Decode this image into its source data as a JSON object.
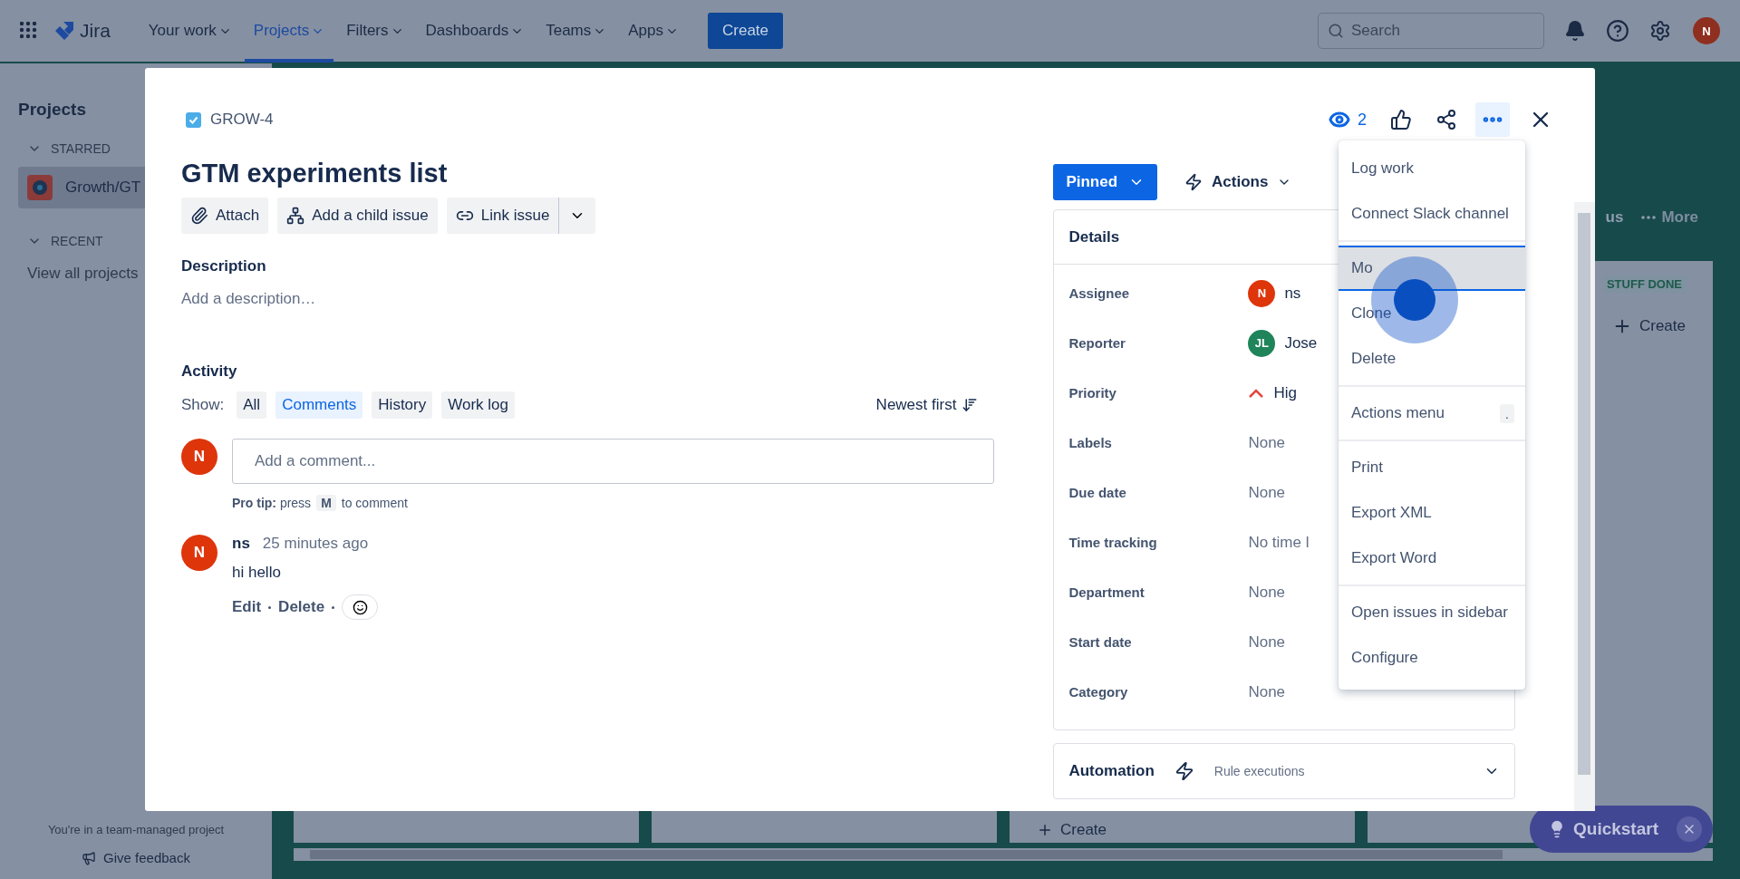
{
  "top_nav": {
    "product": "Jira",
    "items": [
      {
        "label": "Your work",
        "selected": false
      },
      {
        "label": "Projects",
        "selected": true
      },
      {
        "label": "Filters",
        "selected": false
      },
      {
        "label": "Dashboards",
        "selected": false
      },
      {
        "label": "Teams",
        "selected": false
      },
      {
        "label": "Apps",
        "selected": false
      }
    ],
    "create_button": "Create",
    "search": {
      "placeholder": "Search"
    },
    "avatar": "N"
  },
  "sidebar": {
    "title": "Projects",
    "starred_label": "STARRED",
    "starred_items": [
      {
        "label": "Growth/GT",
        "selected": true
      }
    ],
    "recent_label": "RECENT",
    "view_all": "View all projects",
    "footer_note": "You're in a team-managed project",
    "feedback": "Give feedback"
  },
  "board": {
    "header_fragment": "us",
    "more_button": "More",
    "column_tag": "STUFF DONE",
    "create_buttons": [
      "Create",
      "Create"
    ]
  },
  "quickstart": {
    "label": "Quickstart"
  },
  "issue": {
    "key": "GROW-4",
    "watchers": "2",
    "title": "GTM experiments list",
    "actions": [
      "Attach",
      "Add a child issue",
      "Link issue"
    ],
    "description_label": "Description",
    "description_placeholder": "Add a description…",
    "activity": {
      "label": "Activity",
      "show_label": "Show:",
      "filters": [
        {
          "label": "All",
          "selected": false
        },
        {
          "label": "Comments",
          "selected": true
        },
        {
          "label": "History",
          "selected": false
        },
        {
          "label": "Work log",
          "selected": false
        }
      ],
      "sort": "Newest first",
      "comment_box": {
        "avatar": "N",
        "placeholder": "Add a comment..."
      },
      "pro_tip": {
        "text": "**Pro tip:** press",
        "key": "M",
        "after": "to comment"
      },
      "comments": [
        {
          "author": "ns",
          "avatar": "N",
          "time": "25 minutes ago",
          "body": "hi hello",
          "links": [
            "Edit",
            "Delete"
          ]
        }
      ]
    },
    "status_button": "Pinned",
    "actions_button": "Actions",
    "details": {
      "title": "Details",
      "expanded": true,
      "fields": [
        {
          "label": "Assignee",
          "kind": "user",
          "avatar": "N",
          "color": "#de350b",
          "value": "ns"
        },
        {
          "label": "Reporter",
          "kind": "user",
          "avatar": "JL",
          "color": "#1f845a",
          "value": "Jose"
        },
        {
          "label": "Priority",
          "kind": "priority",
          "value": "Hig"
        },
        {
          "label": "Labels",
          "kind": "text",
          "value": "None"
        },
        {
          "label": "Due date",
          "kind": "text",
          "value": "None"
        },
        {
          "label": "Time tracking",
          "kind": "text",
          "value": "No time l"
        },
        {
          "label": "Department",
          "kind": "text",
          "value": "None"
        },
        {
          "label": "Start date",
          "kind": "text",
          "value": "None"
        },
        {
          "label": "Category",
          "kind": "text",
          "value": "None"
        }
      ]
    },
    "automation": {
      "title": "Automation",
      "link": "Rule executions",
      "expanded": false
    }
  },
  "more_menu": {
    "groups": [
      [
        {
          "label": "Log work",
          "selected": false
        },
        {
          "label": "Connect Slack channel",
          "selected": false
        }
      ],
      [
        {
          "label": "Mo",
          "selected": true
        },
        {
          "label": "Clone",
          "selected": false
        },
        {
          "label": "Delete",
          "selected": false
        }
      ],
      [
        {
          "label": "Actions menu",
          "selected": false,
          "shortcut": "."
        }
      ],
      [
        {
          "label": "Print",
          "selected": false
        },
        {
          "label": "Export XML",
          "selected": false
        },
        {
          "label": "Export Word",
          "selected": false
        }
      ],
      [
        {
          "label": "Open issues in sidebar",
          "selected": false
        },
        {
          "label": "Configure",
          "selected": false
        }
      ]
    ]
  }
}
